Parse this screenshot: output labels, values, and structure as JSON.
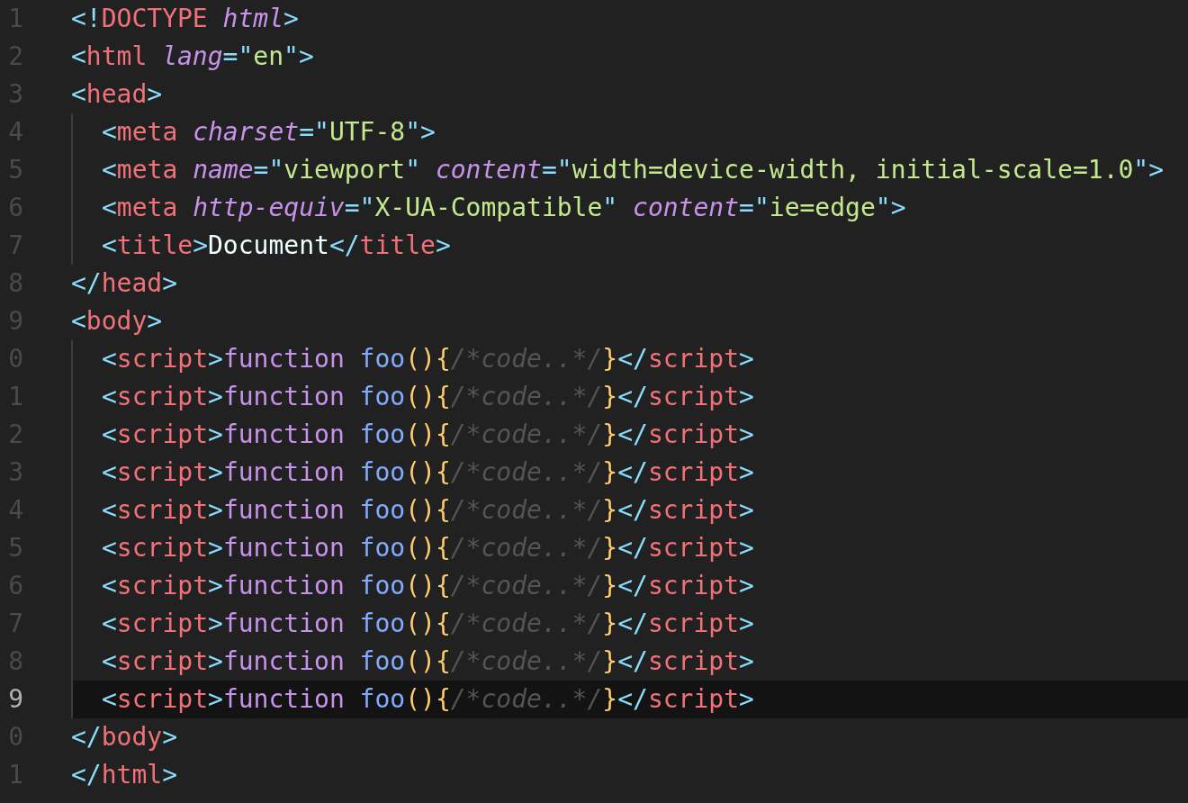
{
  "editor": {
    "lines": [
      {
        "number": "1",
        "current": false,
        "tokens": [
          {
            "kind": "punct",
            "text": "<!"
          },
          {
            "kind": "tag",
            "text": "DOCTYPE "
          },
          {
            "kind": "attr",
            "text": "html"
          },
          {
            "kind": "punct",
            "text": ">"
          }
        ]
      },
      {
        "number": "2",
        "current": false,
        "tokens": [
          {
            "kind": "punct",
            "text": "<"
          },
          {
            "kind": "tag",
            "text": "html "
          },
          {
            "kind": "attr",
            "text": "lang"
          },
          {
            "kind": "punct",
            "text": "=\""
          },
          {
            "kind": "string",
            "text": "en"
          },
          {
            "kind": "punct",
            "text": "\">"
          }
        ]
      },
      {
        "number": "3",
        "current": false,
        "tokens": [
          {
            "kind": "punct",
            "text": "<"
          },
          {
            "kind": "tag",
            "text": "head"
          },
          {
            "kind": "punct",
            "text": ">"
          }
        ],
        "children": [
          {
            "number": "4",
            "current": false,
            "tokens": [
              {
                "kind": "punct",
                "text": "<"
              },
              {
                "kind": "tag",
                "text": "meta "
              },
              {
                "kind": "attr",
                "text": "charset"
              },
              {
                "kind": "punct",
                "text": "=\""
              },
              {
                "kind": "string",
                "text": "UTF-8"
              },
              {
                "kind": "punct",
                "text": "\">"
              }
            ]
          },
          {
            "number": "5",
            "current": false,
            "tokens": [
              {
                "kind": "punct",
                "text": "<"
              },
              {
                "kind": "tag",
                "text": "meta "
              },
              {
                "kind": "attr",
                "text": "name"
              },
              {
                "kind": "punct",
                "text": "=\""
              },
              {
                "kind": "string",
                "text": "viewport"
              },
              {
                "kind": "punct",
                "text": "\" "
              },
              {
                "kind": "attr",
                "text": "content"
              },
              {
                "kind": "punct",
                "text": "=\""
              },
              {
                "kind": "string",
                "text": "width=device-width, initial-scale=1.0"
              },
              {
                "kind": "punct",
                "text": "\">"
              }
            ]
          },
          {
            "number": "6",
            "current": false,
            "tokens": [
              {
                "kind": "punct",
                "text": "<"
              },
              {
                "kind": "tag",
                "text": "meta "
              },
              {
                "kind": "attr",
                "text": "http-equiv"
              },
              {
                "kind": "punct",
                "text": "=\""
              },
              {
                "kind": "string",
                "text": "X-UA-Compatible"
              },
              {
                "kind": "punct",
                "text": "\" "
              },
              {
                "kind": "attr",
                "text": "content"
              },
              {
                "kind": "punct",
                "text": "=\""
              },
              {
                "kind": "string",
                "text": "ie=edge"
              },
              {
                "kind": "punct",
                "text": "\">"
              }
            ]
          },
          {
            "number": "7",
            "current": false,
            "tokens": [
              {
                "kind": "punct",
                "text": "<"
              },
              {
                "kind": "tag",
                "text": "title"
              },
              {
                "kind": "punct",
                "text": ">"
              },
              {
                "kind": "plain",
                "text": "Document"
              },
              {
                "kind": "punct",
                "text": "</"
              },
              {
                "kind": "tag",
                "text": "title"
              },
              {
                "kind": "punct",
                "text": ">"
              }
            ]
          }
        ]
      },
      {
        "number": "8",
        "current": false,
        "tokens": [
          {
            "kind": "punct",
            "text": "</"
          },
          {
            "kind": "tag",
            "text": "head"
          },
          {
            "kind": "punct",
            "text": ">"
          }
        ]
      },
      {
        "number": "9",
        "current": false,
        "tokens": [
          {
            "kind": "punct",
            "text": "<"
          },
          {
            "kind": "tag",
            "text": "body"
          },
          {
            "kind": "punct",
            "text": ">"
          }
        ],
        "children": [
          {
            "number": "0",
            "current": false,
            "tokens": [
              {
                "kind": "punct",
                "text": "<"
              },
              {
                "kind": "tag",
                "text": "script"
              },
              {
                "kind": "punct",
                "text": ">"
              },
              {
                "kind": "keyword",
                "text": "function "
              },
              {
                "kind": "function",
                "text": "foo"
              },
              {
                "kind": "bracket",
                "text": "(){"
              },
              {
                "kind": "comment",
                "text": "/*code..*/"
              },
              {
                "kind": "bracket",
                "text": "}"
              },
              {
                "kind": "punct",
                "text": "</"
              },
              {
                "kind": "tag",
                "text": "script"
              },
              {
                "kind": "punct",
                "text": ">"
              }
            ]
          },
          {
            "number": "1",
            "current": false,
            "tokens": [
              {
                "kind": "punct",
                "text": "<"
              },
              {
                "kind": "tag",
                "text": "script"
              },
              {
                "kind": "punct",
                "text": ">"
              },
              {
                "kind": "keyword",
                "text": "function "
              },
              {
                "kind": "function",
                "text": "foo"
              },
              {
                "kind": "bracket",
                "text": "(){"
              },
              {
                "kind": "comment",
                "text": "/*code..*/"
              },
              {
                "kind": "bracket",
                "text": "}"
              },
              {
                "kind": "punct",
                "text": "</"
              },
              {
                "kind": "tag",
                "text": "script"
              },
              {
                "kind": "punct",
                "text": ">"
              }
            ]
          },
          {
            "number": "2",
            "current": false,
            "tokens": [
              {
                "kind": "punct",
                "text": "<"
              },
              {
                "kind": "tag",
                "text": "script"
              },
              {
                "kind": "punct",
                "text": ">"
              },
              {
                "kind": "keyword",
                "text": "function "
              },
              {
                "kind": "function",
                "text": "foo"
              },
              {
                "kind": "bracket",
                "text": "(){"
              },
              {
                "kind": "comment",
                "text": "/*code..*/"
              },
              {
                "kind": "bracket",
                "text": "}"
              },
              {
                "kind": "punct",
                "text": "</"
              },
              {
                "kind": "tag",
                "text": "script"
              },
              {
                "kind": "punct",
                "text": ">"
              }
            ]
          },
          {
            "number": "3",
            "current": false,
            "tokens": [
              {
                "kind": "punct",
                "text": "<"
              },
              {
                "kind": "tag",
                "text": "script"
              },
              {
                "kind": "punct",
                "text": ">"
              },
              {
                "kind": "keyword",
                "text": "function "
              },
              {
                "kind": "function",
                "text": "foo"
              },
              {
                "kind": "bracket",
                "text": "(){"
              },
              {
                "kind": "comment",
                "text": "/*code..*/"
              },
              {
                "kind": "bracket",
                "text": "}"
              },
              {
                "kind": "punct",
                "text": "</"
              },
              {
                "kind": "tag",
                "text": "script"
              },
              {
                "kind": "punct",
                "text": ">"
              }
            ]
          },
          {
            "number": "4",
            "current": false,
            "tokens": [
              {
                "kind": "punct",
                "text": "<"
              },
              {
                "kind": "tag",
                "text": "script"
              },
              {
                "kind": "punct",
                "text": ">"
              },
              {
                "kind": "keyword",
                "text": "function "
              },
              {
                "kind": "function",
                "text": "foo"
              },
              {
                "kind": "bracket",
                "text": "(){"
              },
              {
                "kind": "comment",
                "text": "/*code..*/"
              },
              {
                "kind": "bracket",
                "text": "}"
              },
              {
                "kind": "punct",
                "text": "</"
              },
              {
                "kind": "tag",
                "text": "script"
              },
              {
                "kind": "punct",
                "text": ">"
              }
            ]
          },
          {
            "number": "5",
            "current": false,
            "tokens": [
              {
                "kind": "punct",
                "text": "<"
              },
              {
                "kind": "tag",
                "text": "script"
              },
              {
                "kind": "punct",
                "text": ">"
              },
              {
                "kind": "keyword",
                "text": "function "
              },
              {
                "kind": "function",
                "text": "foo"
              },
              {
                "kind": "bracket",
                "text": "(){"
              },
              {
                "kind": "comment",
                "text": "/*code..*/"
              },
              {
                "kind": "bracket",
                "text": "}"
              },
              {
                "kind": "punct",
                "text": "</"
              },
              {
                "kind": "tag",
                "text": "script"
              },
              {
                "kind": "punct",
                "text": ">"
              }
            ]
          },
          {
            "number": "6",
            "current": false,
            "tokens": [
              {
                "kind": "punct",
                "text": "<"
              },
              {
                "kind": "tag",
                "text": "script"
              },
              {
                "kind": "punct",
                "text": ">"
              },
              {
                "kind": "keyword",
                "text": "function "
              },
              {
                "kind": "function",
                "text": "foo"
              },
              {
                "kind": "bracket",
                "text": "(){"
              },
              {
                "kind": "comment",
                "text": "/*code..*/"
              },
              {
                "kind": "bracket",
                "text": "}"
              },
              {
                "kind": "punct",
                "text": "</"
              },
              {
                "kind": "tag",
                "text": "script"
              },
              {
                "kind": "punct",
                "text": ">"
              }
            ]
          },
          {
            "number": "7",
            "current": false,
            "tokens": [
              {
                "kind": "punct",
                "text": "<"
              },
              {
                "kind": "tag",
                "text": "script"
              },
              {
                "kind": "punct",
                "text": ">"
              },
              {
                "kind": "keyword",
                "text": "function "
              },
              {
                "kind": "function",
                "text": "foo"
              },
              {
                "kind": "bracket",
                "text": "(){"
              },
              {
                "kind": "comment",
                "text": "/*code..*/"
              },
              {
                "kind": "bracket",
                "text": "}"
              },
              {
                "kind": "punct",
                "text": "</"
              },
              {
                "kind": "tag",
                "text": "script"
              },
              {
                "kind": "punct",
                "text": ">"
              }
            ]
          },
          {
            "number": "8",
            "current": false,
            "tokens": [
              {
                "kind": "punct",
                "text": "<"
              },
              {
                "kind": "tag",
                "text": "script"
              },
              {
                "kind": "punct",
                "text": ">"
              },
              {
                "kind": "keyword",
                "text": "function "
              },
              {
                "kind": "function",
                "text": "foo"
              },
              {
                "kind": "bracket",
                "text": "(){"
              },
              {
                "kind": "comment",
                "text": "/*code..*/"
              },
              {
                "kind": "bracket",
                "text": "}"
              },
              {
                "kind": "punct",
                "text": "</"
              },
              {
                "kind": "tag",
                "text": "script"
              },
              {
                "kind": "punct",
                "text": ">"
              }
            ]
          },
          {
            "number": "9",
            "current": true,
            "tokens": [
              {
                "kind": "punct",
                "text": "<"
              },
              {
                "kind": "tag",
                "text": "script"
              },
              {
                "kind": "punct",
                "text": ">"
              },
              {
                "kind": "keyword",
                "text": "function "
              },
              {
                "kind": "function",
                "text": "foo"
              },
              {
                "kind": "bracket",
                "text": "(){"
              },
              {
                "kind": "comment",
                "text": "/*code..*/"
              },
              {
                "kind": "bracket",
                "text": "}"
              },
              {
                "kind": "punct",
                "text": "</"
              },
              {
                "kind": "tag",
                "text": "script"
              },
              {
                "kind": "punct",
                "text": ">"
              }
            ]
          }
        ]
      },
      {
        "number": "0",
        "current": false,
        "tokens": [
          {
            "kind": "punct",
            "text": "</"
          },
          {
            "kind": "tag",
            "text": "body"
          },
          {
            "kind": "punct",
            "text": ">"
          }
        ]
      },
      {
        "number": "1",
        "current": false,
        "tokens": [
          {
            "kind": "punct",
            "text": "</"
          },
          {
            "kind": "tag",
            "text": "html"
          },
          {
            "kind": "punct",
            "text": ">"
          }
        ]
      }
    ]
  }
}
